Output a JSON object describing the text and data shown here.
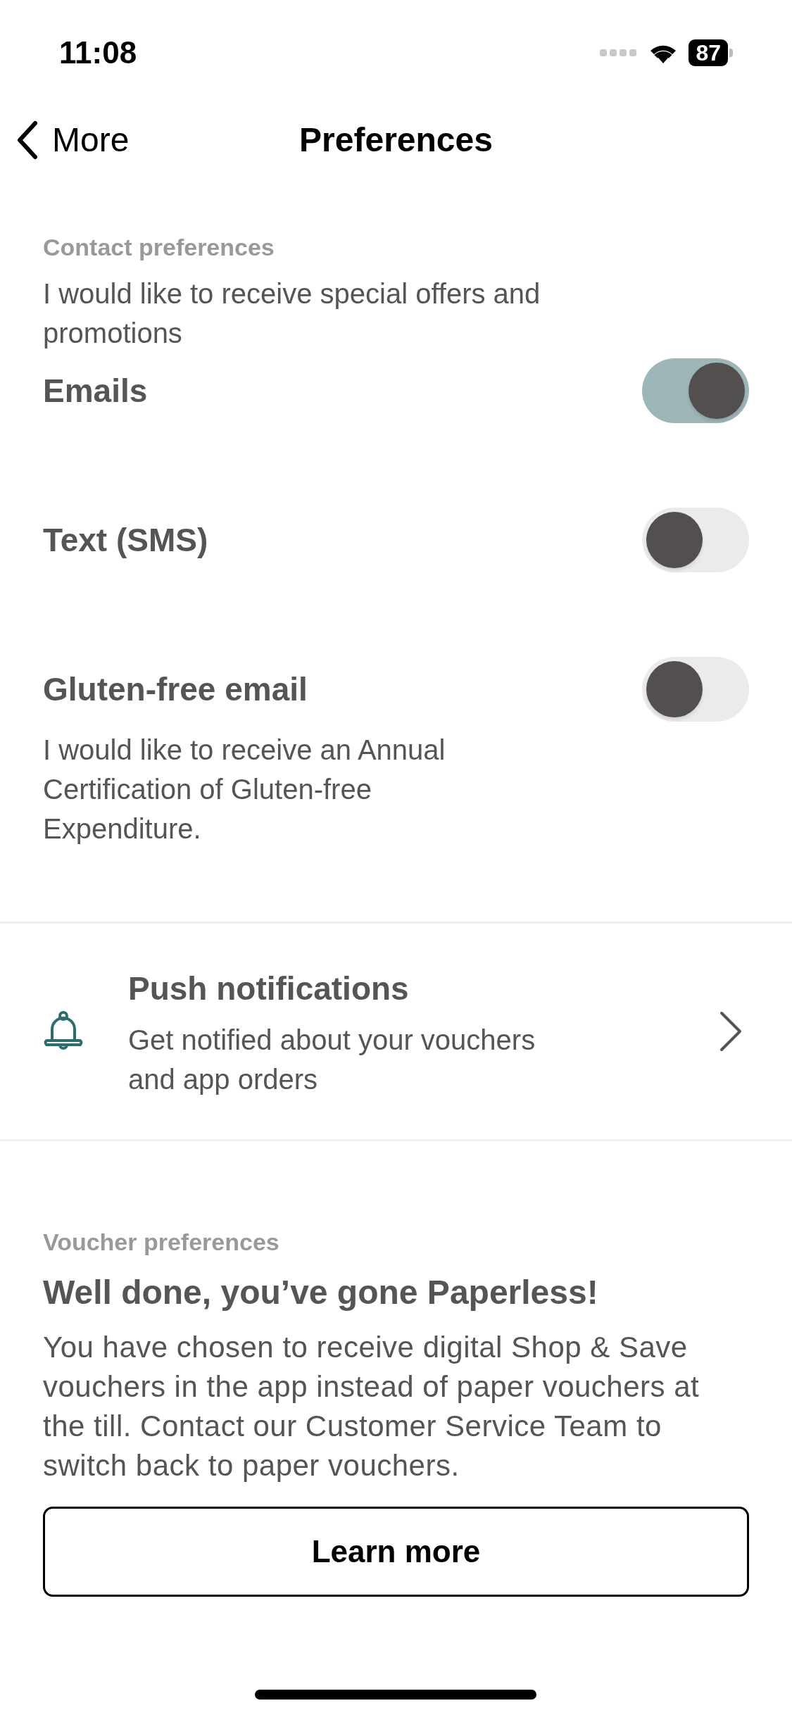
{
  "status_bar": {
    "time": "11:08",
    "battery": "87"
  },
  "nav": {
    "back": "More",
    "title": "Preferences"
  },
  "contact": {
    "label": "Contact preferences",
    "intro": "I would like to receive special offers and promotions",
    "toggles": [
      {
        "label": "Emails",
        "on": true
      },
      {
        "label": "Text (SMS)",
        "on": false
      },
      {
        "label": "Gluten-free email",
        "on": false,
        "note": "I would like to receive an Annual Certification of Gluten-free Expenditure."
      }
    ]
  },
  "push": {
    "title": "Push notifications",
    "subtitle": "Get notified about your vouchers and app orders"
  },
  "voucher": {
    "label": "Voucher preferences",
    "title": "Well done, you’ve gone Paperless!",
    "body": "You have chosen to receive digital Shop & Save vouchers in the app instead of paper vouchers at the till. Contact our Customer Service Team to switch back to paper vouchers.",
    "button": "Learn more"
  }
}
